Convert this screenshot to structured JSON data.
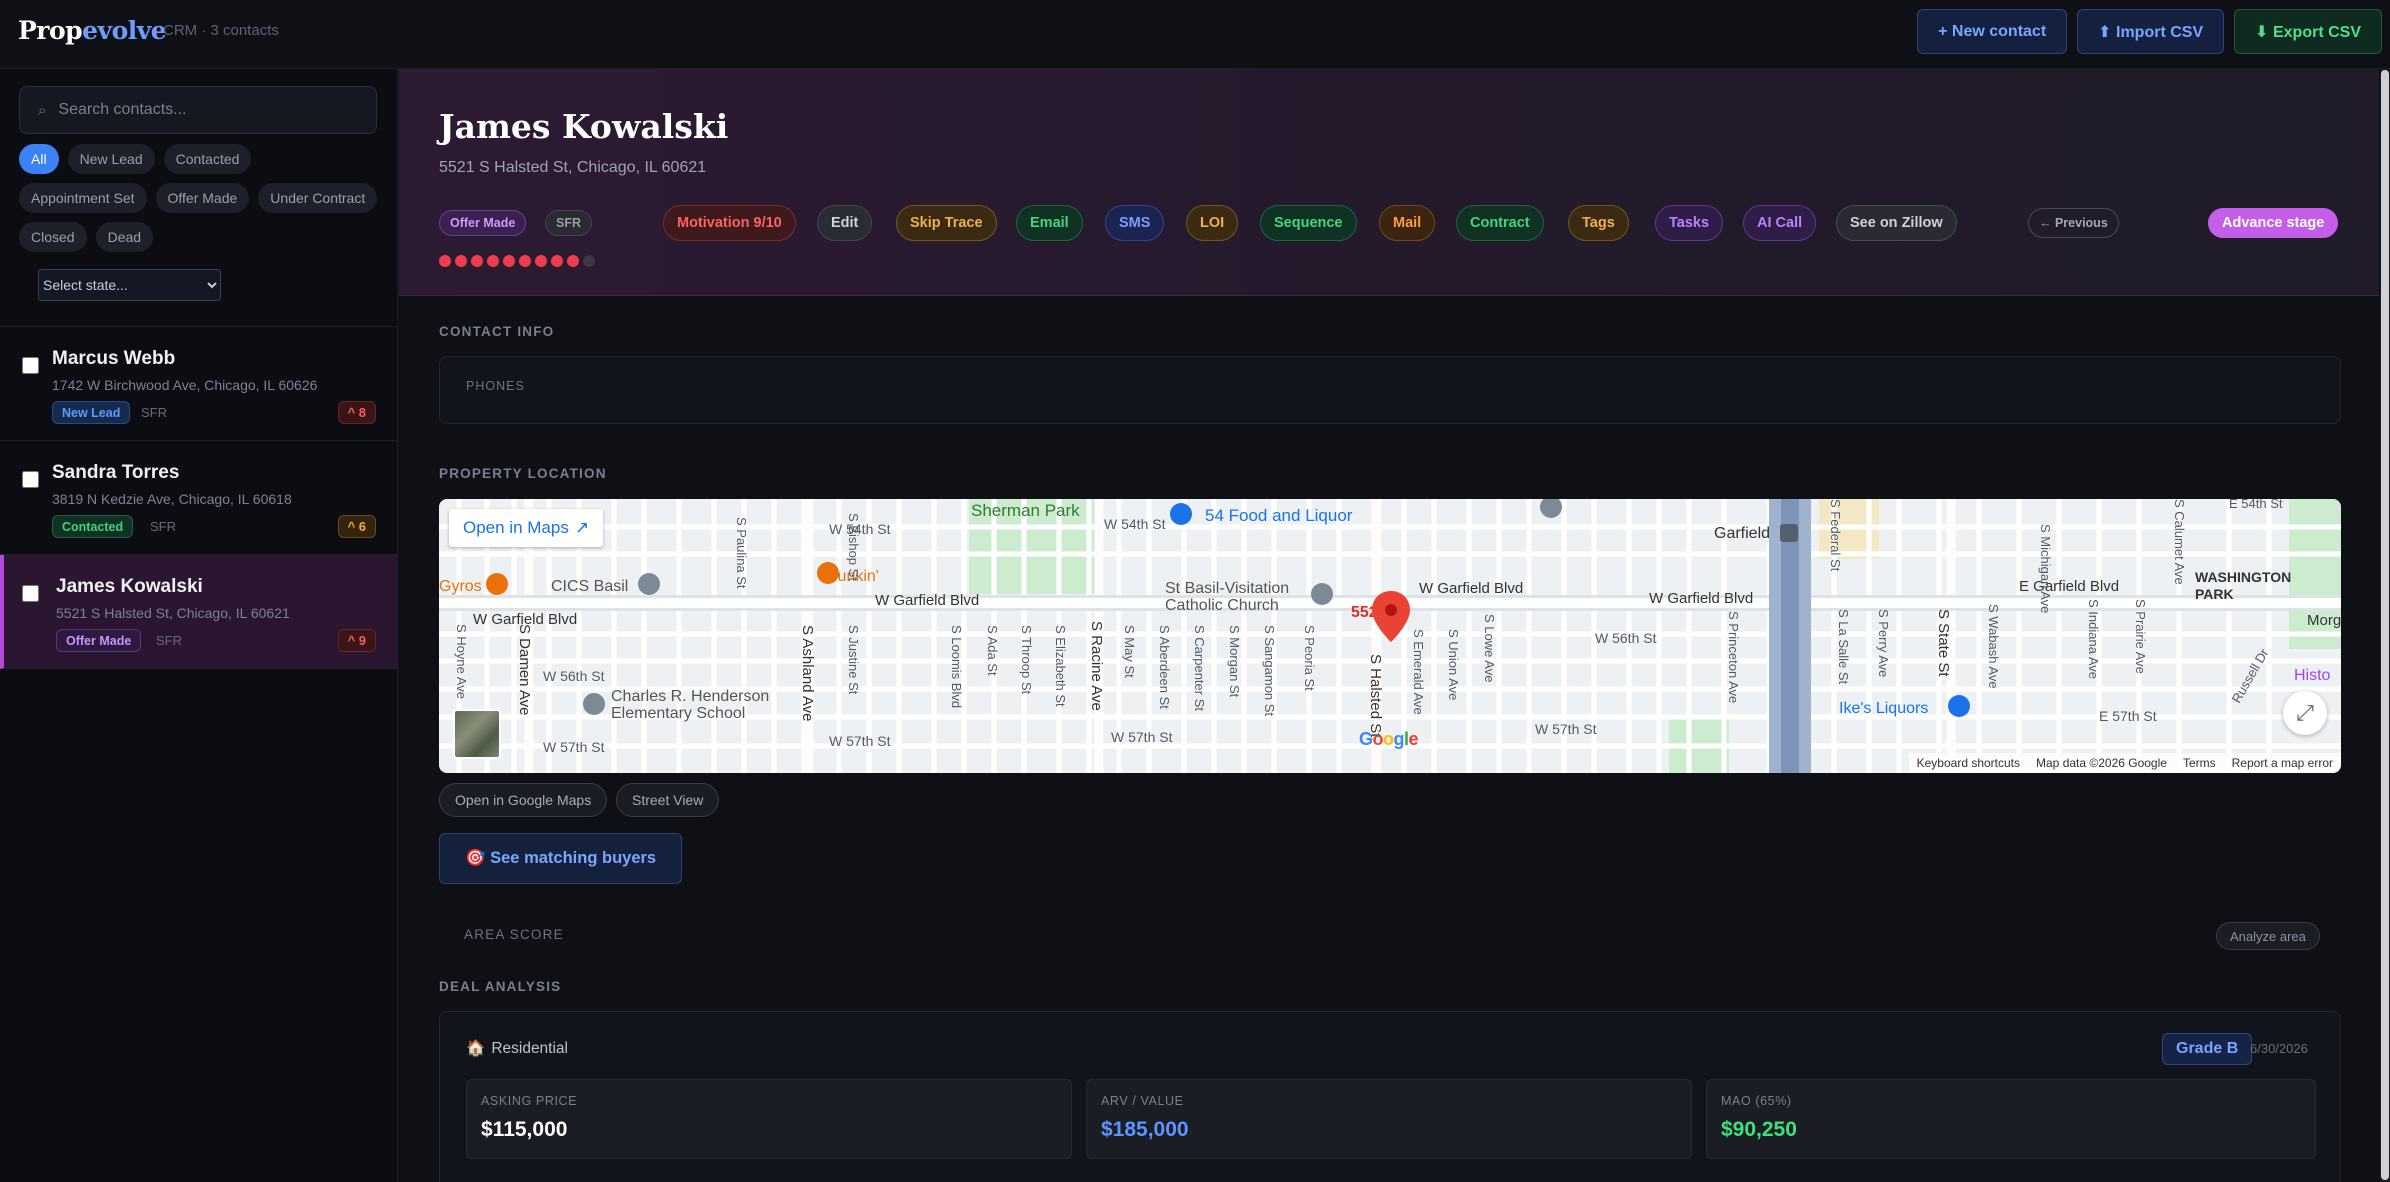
{
  "app": {
    "brand_a": "Prop",
    "brand_b": "evolve",
    "subtitle": "CRM · 3 contacts"
  },
  "top_actions": {
    "new_contact": "+ New contact",
    "import_csv": "⬆ Import CSV",
    "export_csv": "⬇ Export CSV"
  },
  "sidebar": {
    "search_placeholder": "Search contacts...",
    "filters": [
      "All",
      "New Lead",
      "Contacted",
      "Appointment Set",
      "Offer Made",
      "Under Contract",
      "Closed",
      "Dead"
    ],
    "state_select": "Select state...",
    "contacts": [
      {
        "name": "Marcus Webb",
        "address": "1742 W Birchwood Ave, Chicago, IL 60626",
        "stage": "New Lead",
        "type": "SFR",
        "score": "^ 8"
      },
      {
        "name": "Sandra Torres",
        "address": "3819 N Kedzie Ave, Chicago, IL 60618",
        "stage": "Contacted",
        "type": "SFR",
        "score": "^ 6"
      },
      {
        "name": "James Kowalski",
        "address": "5521 S Halsted St, Chicago, IL 60621",
        "stage": "Offer Made",
        "type": "SFR",
        "score": "^ 9"
      }
    ]
  },
  "detail": {
    "name": "James Kowalski",
    "address": "5521 S Halsted St, Chicago, IL 60621",
    "stage": "Offer Made",
    "type": "SFR",
    "motivation": "Motivation 9/10",
    "motivation_level": 9,
    "motivation_max": 10,
    "actions": {
      "edit": "Edit",
      "skip_trace": "Skip Trace",
      "email": "Email",
      "sms": "SMS",
      "loi": "LOI",
      "sequence": "Sequence",
      "mail": "Mail",
      "contract": "Contract",
      "tags": "Tags",
      "tasks": "Tasks",
      "ai_call": "AI Call",
      "zillow": "See on Zillow",
      "previous": "← Previous",
      "advance": "Advance stage"
    }
  },
  "contact_info": {
    "label": "CONTACT INFO",
    "phones_label": "PHONES"
  },
  "property_location": {
    "label": "PROPERTY LOCATION",
    "open_in_maps": "Open in Maps",
    "pin_label": "5521",
    "map_labels": {
      "sherman_park": "Sherman Park",
      "food_liquor": "54 Food and Liquor",
      "garfield_station": "Garfield",
      "w54th": "W 54th St",
      "w54th_2": "W 54th St",
      "s_paulina": "S Paulina St",
      "s_bishop": "S Bishop St",
      "dunkin": "Dunkin'",
      "gyros": "Gyros",
      "cics": "CICS Basil",
      "st_basil": "St Basil-Visitation\nCatholic Church",
      "w_garfield_1": "W Garfield Blvd",
      "w_garfield_2": "W Garfield Blvd",
      "w_garfield_3": "W Garfield Blvd",
      "w_garfield_4": "W Garfield Blvd",
      "e_garfield": "E Garfield Blvd",
      "washington_park": "WASHINGTON\nPARK",
      "morgan": "Morg",
      "w56th_1": "W 56th St",
      "w56th_2": "W 56th St",
      "w57th_1": "W 57th St",
      "w57th_2": "W 57th St",
      "w57th_3": "W 57th St",
      "e57th": "E 57th St",
      "e54th": "E 54th St",
      "henderson": "Charles R. Henderson\nElementary School",
      "ikes": "Ike's Liquors",
      "histo": "Histo",
      "s_hoyne": "S Hoyne Ave",
      "s_damen": "S Damen Ave",
      "s_ashland": "S Ashland Ave",
      "s_justine": "S Justine St",
      "s_loomis": "S Loomis Blvd",
      "s_ada": "S Ada St",
      "s_throop": "S Throop St",
      "s_elizabeth": "S Elizabeth St",
      "s_racine": "S Racine Ave",
      "s_may": "S May St",
      "s_aberdeen": "S Aberdeen St",
      "s_carpenter": "S Carpenter St",
      "s_morgan": "S Morgan St",
      "s_sangamon": "S Sangamon St",
      "s_peoria": "S Peoria St",
      "s_halsted": "S Halsted St",
      "s_emerald": "S Emerald Ave",
      "s_union": "S Union Ave",
      "s_lowe": "S Lowe Ave",
      "s_princeton": "S Princeton Ave",
      "s_lasalle": "S La Salle St",
      "s_perry": "S Perry Ave",
      "s_state": "S State St",
      "s_wabash": "S Wabash Ave",
      "s_michigan": "S Michigan Ave",
      "s_indiana": "S Indiana Ave",
      "s_prairie": "S Prairie Ave",
      "s_federal": "S Federal St",
      "s_calumet": "S Calumet Ave",
      "russell": "Russell Dr"
    },
    "google": "Google",
    "footer": {
      "shortcuts": "Keyboard shortcuts",
      "map_data": "Map data ©2026 Google",
      "terms": "Terms",
      "report": "Report a map error"
    },
    "open_google_maps": "Open in Google Maps",
    "street_view": "Street View"
  },
  "buyers_button": "🎯 See matching buyers",
  "area_score": {
    "label": "AREA SCORE",
    "analyze": "Analyze area"
  },
  "deal_analysis": {
    "label": "DEAL ANALYSIS",
    "kind_icon": "🏠",
    "kind": "Residential",
    "grade": "Grade B",
    "date": "6/30/2026",
    "stats": [
      {
        "label": "ASKING PRICE",
        "value": "$115,000",
        "color": "#ffffff"
      },
      {
        "label": "ARV / VALUE",
        "value": "$185,000",
        "color": "#5b93ff"
      },
      {
        "label": "MAO (65%)",
        "value": "$90,250",
        "color": "#3ee07c"
      }
    ]
  },
  "colors": {
    "accent": "#3b82f6",
    "stage_purple": "#c45ee8",
    "motivation_red": "#ef3e4f"
  }
}
